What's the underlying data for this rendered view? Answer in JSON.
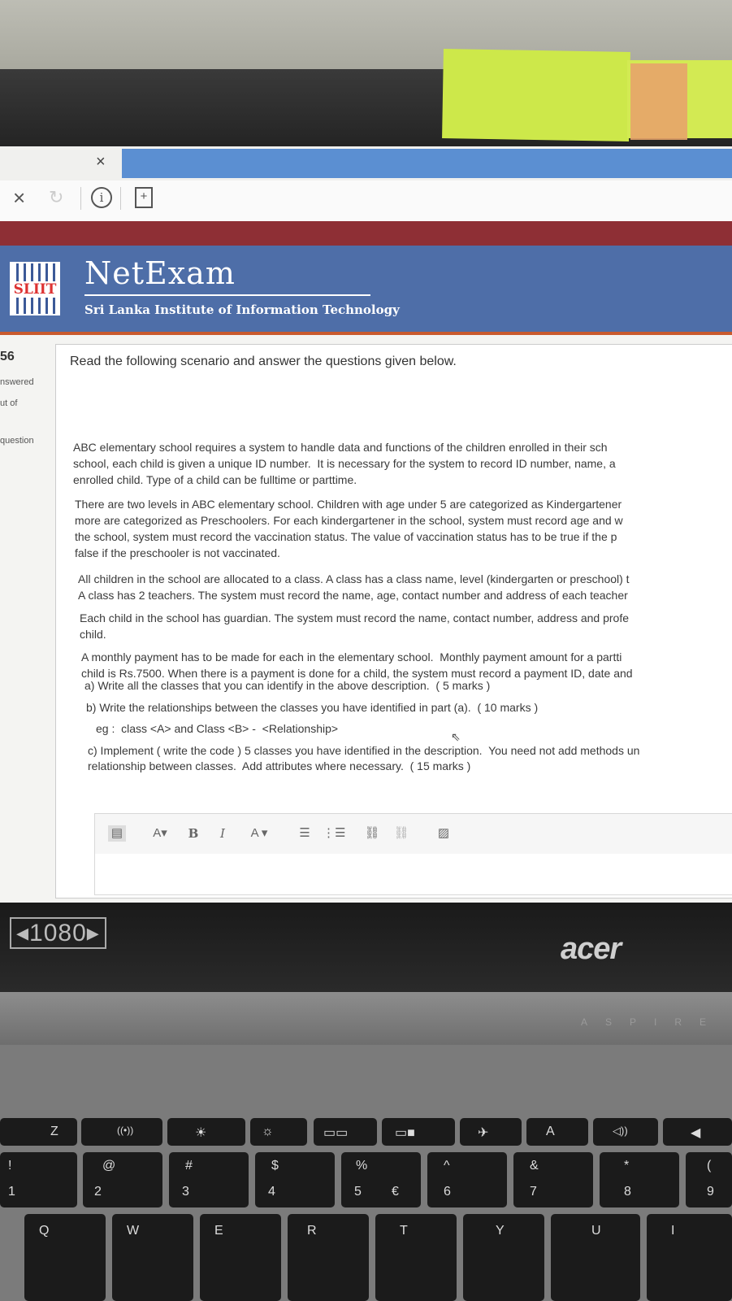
{
  "browser": {
    "tab_close": "×",
    "nav_close": "×",
    "nav_reload": "↻",
    "nav_info": "i",
    "nav_page": "+"
  },
  "header": {
    "logo_text": "SLIIT",
    "title": "NetExam",
    "subtitle": "Sri Lanka Institute of Information Technology"
  },
  "sidebar": {
    "number": "56",
    "line1": "nswered",
    "line2": "ut of",
    "line3": "question"
  },
  "question": {
    "intro": "Read the following scenario and answer the questions given below.",
    "p1": [
      "ABC elementary school requires a system to handle data and functions of the children enrolled in their sch",
      "school, each child is given a unique ID number.  It is necessary for the system to record ID number, name, a",
      "enrolled child. Type of a child can be fulltime or parttime."
    ],
    "p2": [
      "There are two levels in ABC elementary school. Children with age under 5 are categorized as Kindergartener",
      "more are categorized as Preschoolers. For each kindergartener in the school, system must record age and w",
      "the school, system must record the vaccination status. The value of vaccination status has to be true if the p",
      "false if the preschooler is not vaccinated."
    ],
    "p3": [
      "All children in the school are allocated to a class. A class has a class name, level (kindergarten or preschool) t",
      "A class has 2 teachers. The system must record the name, age, contact number and address of each teacher"
    ],
    "p4": [
      "Each child in the school has guardian. The system must record the name, contact number, address and profe",
      "child."
    ],
    "p5": [
      "A monthly payment has to be made for each in the elementary school.  Monthly payment amount for a partti",
      "child is Rs.7500. When there is a payment is done for a child, the system must record a payment ID, date and"
    ],
    "qa": "a) Write all the classes that you can identify in the above description.  ( 5 marks )",
    "qb": "b) Write the relationships between the classes you have identified in part (a).  ( 10 marks )",
    "qb_eg": "eg :  class <A> and Class <B> -  <Relationship>",
    "qc1": "c) Implement ( write the code ) 5 classes you have identified in the description.  You need not add methods un",
    "qc2": "relationship between classes.  Add attributes where necessary.  ( 15 marks )"
  },
  "editor_toolbar": {
    "format_icon": "▤",
    "font_size": "A▾",
    "bold": "B",
    "italic": "I",
    "font_color": "A ▾",
    "bullet_list": "☰",
    "numbered_list": "⋮☰",
    "link": "⛓",
    "unlink": "⛓",
    "image": "▨"
  },
  "laptop": {
    "sticker": "◂1080▸",
    "brand": "acer",
    "aspire": "ASPIRE",
    "fn_keys": [
      "Z",
      "((•))",
      "☀",
      "☼",
      "▭▭",
      "▭■",
      "✈",
      "A",
      "◁))",
      "◀"
    ],
    "num_keys": [
      {
        "top": "!",
        "bottom": "1"
      },
      {
        "top": "@",
        "bottom": "2"
      },
      {
        "top": "#",
        "bottom": "3"
      },
      {
        "top": "$",
        "bottom": "4"
      },
      {
        "top": "%",
        "bottom": "5"
      },
      {
        "top": "",
        "bottom": "€"
      },
      {
        "top": "^",
        "bottom": "6"
      },
      {
        "top": "&",
        "bottom": "7"
      },
      {
        "top": "*",
        "bottom": "8"
      },
      {
        "top": "(",
        "bottom": "9"
      }
    ],
    "letter_keys": [
      "Q",
      "W",
      "E",
      "R",
      "T",
      "Y",
      "U",
      "I"
    ]
  }
}
